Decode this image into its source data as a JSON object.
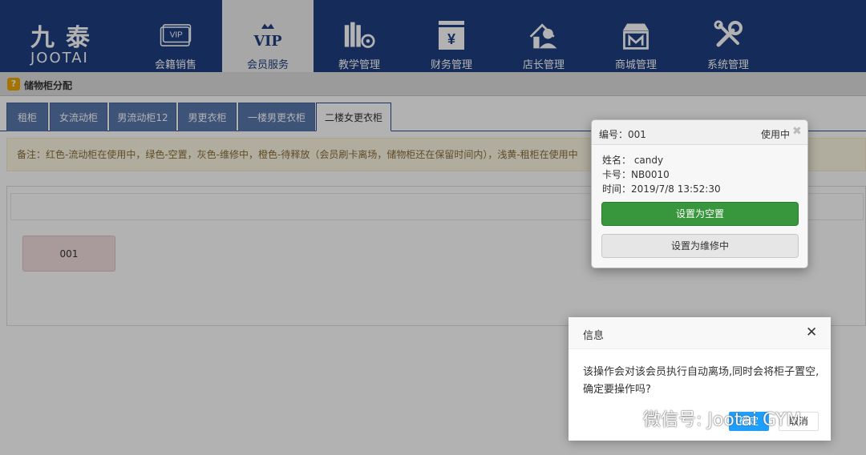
{
  "logo": {
    "cn": "九泰",
    "en": "JOOTAI"
  },
  "nav": [
    {
      "label": "会籍销售",
      "icon": "vip-card-icon"
    },
    {
      "label": "会员服务",
      "icon": "vip-crown-icon",
      "active": true,
      "icon_text": "VIP"
    },
    {
      "label": "教学管理",
      "icon": "books-gear-icon"
    },
    {
      "label": "财务管理",
      "icon": "cash-box-icon",
      "icon_text": "¥"
    },
    {
      "label": "店长管理",
      "icon": "manager-icon"
    },
    {
      "label": "商城管理",
      "icon": "shop-icon"
    },
    {
      "label": "系统管理",
      "icon": "tools-icon"
    }
  ],
  "vip_card_text": "VIP",
  "breadcrumb": {
    "title": "储物柜分配"
  },
  "tabs": [
    {
      "label": "租柜"
    },
    {
      "label": "女流动柜"
    },
    {
      "label": "男流动柜12"
    },
    {
      "label": "男更衣柜"
    },
    {
      "label": "一楼男更衣柜"
    },
    {
      "label": "二楼女更衣柜",
      "active": true
    }
  ],
  "notice": "备注：红色-流动柜在使用中，绿色-空置，灰色-维修中，橙色-待释放（会员刷卡离场，储物柜还在保留时间内），浅黄-租柜在使用中",
  "cabinets": [
    {
      "label": "001",
      "status": "red"
    }
  ],
  "popover": {
    "number": "编号：001",
    "status": "使用中",
    "name": "姓名： candy",
    "card": "卡号：NB0010",
    "time": "时间：2019/7/8 13:52:30",
    "btn_empty": "设置为空置",
    "btn_repair": "设置为维修中"
  },
  "dialog": {
    "title": "信息",
    "body": "该操作会对该会员执行自动离场,同时会将柜子置空,确定要操作吗?",
    "ok": "确定",
    "cancel": "取消"
  },
  "watermark": "微信号: Jootai GYM",
  "colors": {
    "header": "#1f3f82",
    "tab": "#5a78ad",
    "green": "#38963c",
    "primary": "#1e9fff"
  }
}
